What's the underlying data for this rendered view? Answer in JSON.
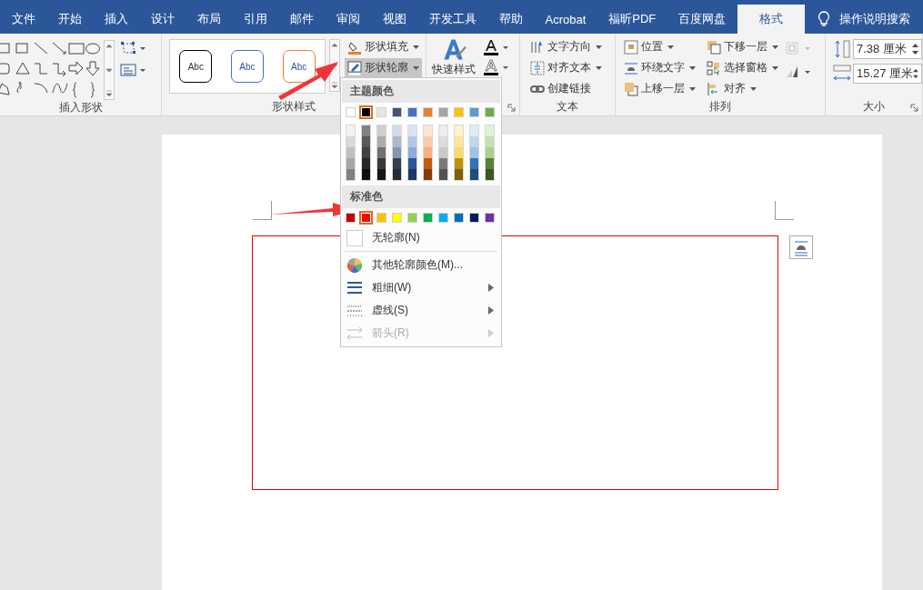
{
  "tabs": [
    {
      "label": "文件",
      "selected": false
    },
    {
      "label": "开始",
      "selected": false
    },
    {
      "label": "插入",
      "selected": false
    },
    {
      "label": "设计",
      "selected": false
    },
    {
      "label": "布局",
      "selected": false
    },
    {
      "label": "引用",
      "selected": false
    },
    {
      "label": "邮件",
      "selected": false
    },
    {
      "label": "审阅",
      "selected": false
    },
    {
      "label": "视图",
      "selected": false
    },
    {
      "label": "开发工具",
      "selected": false
    },
    {
      "label": "帮助",
      "selected": false
    },
    {
      "label": "Acrobat",
      "selected": false
    },
    {
      "label": "福昕PDF",
      "selected": false
    },
    {
      "label": "百度网盘",
      "selected": false
    },
    {
      "label": "格式",
      "selected": true
    }
  ],
  "tell_me": "操作说明搜索",
  "insert_shapes": {
    "label": "插入形状"
  },
  "shape_styles": {
    "label": "形状样式",
    "presets": [
      {
        "label": "Abc",
        "color": "#000000"
      },
      {
        "label": "Abc",
        "color": "#4472c4"
      },
      {
        "label": "Abc",
        "color": "#ed7d31"
      }
    ],
    "fill": "形状填充",
    "outline": "形状轮廓",
    "outline_open": true
  },
  "wordart": {
    "quick_styles": "快速样式"
  },
  "text_group": {
    "label": "文本",
    "items": [
      {
        "label": "文字方向",
        "kind": "direction",
        "dropdown": true
      },
      {
        "label": "对齐文本",
        "kind": "align",
        "dropdown": true
      },
      {
        "label": "创建链接",
        "kind": "link",
        "dropdown": false
      }
    ]
  },
  "arrange": {
    "label": "排列",
    "left": [
      {
        "label": "位置",
        "kind": "position"
      },
      {
        "label": "环绕文字",
        "kind": "wrap"
      },
      {
        "label": "上移一层",
        "kind": "forward"
      }
    ],
    "right": [
      {
        "label": "下移一层",
        "kind": "backward"
      },
      {
        "label": "选择窗格",
        "kind": "pane"
      },
      {
        "label": "对齐",
        "kind": "alignobj"
      }
    ]
  },
  "size": {
    "label": "大小",
    "height": "7.38 厘米",
    "width": "15.27 厘米"
  },
  "outline_menu": {
    "theme_heading": "主题颜色",
    "theme_colors": [
      {
        "color": "#ffffff",
        "selected": false,
        "shades": [
          {
            "color": "#f2f2f2"
          },
          {
            "color": "#d9d9d9"
          },
          {
            "color": "#bfbfbf"
          },
          {
            "color": "#a6a6a6"
          },
          {
            "color": "#808080"
          }
        ]
      },
      {
        "color": "#000000",
        "selected": true,
        "shades": [
          {
            "color": "#808080"
          },
          {
            "color": "#595959"
          },
          {
            "color": "#404040"
          },
          {
            "color": "#262626"
          },
          {
            "color": "#0d0d0d"
          }
        ]
      },
      {
        "color": "#e7e6e6",
        "selected": false,
        "shades": [
          {
            "color": "#d0cece"
          },
          {
            "color": "#aeaaaa"
          },
          {
            "color": "#757171"
          },
          {
            "color": "#3a3838"
          },
          {
            "color": "#171616"
          }
        ]
      },
      {
        "color": "#44546a",
        "selected": false,
        "shades": [
          {
            "color": "#d6dce5"
          },
          {
            "color": "#adb9ca"
          },
          {
            "color": "#8497b0"
          },
          {
            "color": "#333f50"
          },
          {
            "color": "#222a35"
          }
        ]
      },
      {
        "color": "#4472c4",
        "selected": false,
        "shades": [
          {
            "color": "#dae3f3"
          },
          {
            "color": "#b4c7e7"
          },
          {
            "color": "#8faadc"
          },
          {
            "color": "#2f5597"
          },
          {
            "color": "#203864"
          }
        ]
      },
      {
        "color": "#ed7d31",
        "selected": false,
        "shades": [
          {
            "color": "#fbe5d6"
          },
          {
            "color": "#f8cbad"
          },
          {
            "color": "#f4b183"
          },
          {
            "color": "#c55a11"
          },
          {
            "color": "#843c0c"
          }
        ]
      },
      {
        "color": "#a5a5a5",
        "selected": false,
        "shades": [
          {
            "color": "#ededed"
          },
          {
            "color": "#dbdbdb"
          },
          {
            "color": "#c9c9c9"
          },
          {
            "color": "#7b7b7b"
          },
          {
            "color": "#525252"
          }
        ]
      },
      {
        "color": "#ffc000",
        "selected": false,
        "shades": [
          {
            "color": "#fff2cc"
          },
          {
            "color": "#ffe699"
          },
          {
            "color": "#ffd966"
          },
          {
            "color": "#bf9000"
          },
          {
            "color": "#7f6000"
          }
        ]
      },
      {
        "color": "#5b9bd5",
        "selected": false,
        "shades": [
          {
            "color": "#deebf7"
          },
          {
            "color": "#bdd7ee"
          },
          {
            "color": "#9dc3e6"
          },
          {
            "color": "#2e75b6"
          },
          {
            "color": "#1f4e79"
          }
        ]
      },
      {
        "color": "#70ad47",
        "selected": false,
        "shades": [
          {
            "color": "#e2f0d9"
          },
          {
            "color": "#c5e0b4"
          },
          {
            "color": "#a9d18e"
          },
          {
            "color": "#548235"
          },
          {
            "color": "#385723"
          }
        ]
      }
    ],
    "standard_heading": "标准色",
    "standard_colors": [
      {
        "color": "#c00000",
        "selected": false
      },
      {
        "color": "#ff0000",
        "selected": true
      },
      {
        "color": "#ffc000",
        "selected": false
      },
      {
        "color": "#ffff00",
        "selected": false
      },
      {
        "color": "#92d050",
        "selected": false
      },
      {
        "color": "#00b050",
        "selected": false
      },
      {
        "color": "#00b0f0",
        "selected": false
      },
      {
        "color": "#0070c0",
        "selected": false
      },
      {
        "color": "#002060",
        "selected": false
      },
      {
        "color": "#7030a0",
        "selected": false
      }
    ],
    "items": [
      {
        "label": "无轮廓(N)",
        "kind": "none",
        "submenu": false,
        "disabled": false
      },
      {
        "label": "其他轮廓颜色(M)...",
        "kind": "more",
        "submenu": false,
        "disabled": false
      },
      {
        "label": "粗细(W)",
        "kind": "weight",
        "submenu": true,
        "disabled": false
      },
      {
        "label": "虚线(S)",
        "kind": "dash",
        "submenu": true,
        "disabled": false
      },
      {
        "label": "箭头(R)",
        "kind": "arrow",
        "submenu": true,
        "disabled": true
      }
    ]
  }
}
